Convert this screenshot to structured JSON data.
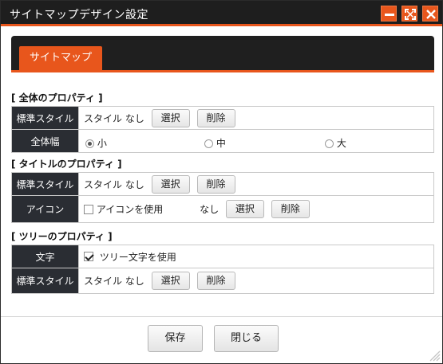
{
  "window": {
    "title": "サイトマップデザイン設定",
    "accent": "#e8561c"
  },
  "tabs": [
    "サイトマップ"
  ],
  "sections": {
    "global": {
      "title": "[ 全体のプロパティ ]",
      "style_label": "標準スタイル",
      "style_value": "スタイル なし",
      "select": "選択",
      "delete": "削除",
      "width_label": "全体幅",
      "width_options": [
        "小",
        "中",
        "大"
      ],
      "width_selected": "小"
    },
    "title_props": {
      "title": "[ タイトルのプロパティ ]",
      "style_label": "標準スタイル",
      "style_value": "スタイル なし",
      "select": "選択",
      "delete": "削除",
      "icon_label": "アイコン",
      "icon_checkbox": "アイコンを使用",
      "icon_checked": false,
      "icon_value": "なし",
      "icon_select": "選択",
      "icon_delete": "削除"
    },
    "tree": {
      "title": "[ ツリーのプロパティ ]",
      "text_label": "文字",
      "text_checkbox": "ツリー文字を使用",
      "text_checked": true,
      "style_label": "標準スタイル",
      "style_value": "スタイル なし",
      "select": "選択",
      "delete": "削除"
    }
  },
  "footer": {
    "save": "保存",
    "close": "閉じる"
  }
}
